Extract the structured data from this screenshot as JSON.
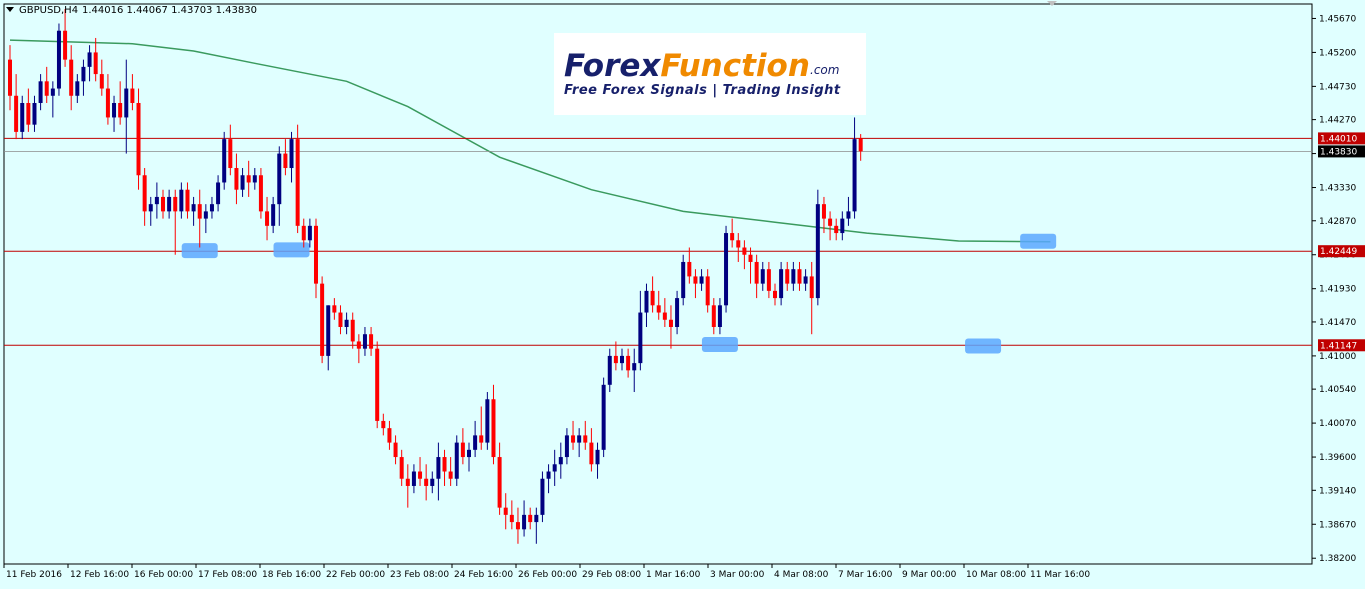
{
  "header": {
    "symbol": "GBPUSD,H4",
    "ohlc": "1.44016 1.44067 1.43703 1.43830"
  },
  "logo": {
    "brand_part1": "Forex",
    "brand_part2": "Function",
    "domain": ".com",
    "tagline": "Free Forex Signals | Trading Insight"
  },
  "colors": {
    "background": "#e0ffff",
    "bull_candle": "#000080",
    "bear_candle": "#ff0000",
    "moving_average": "#3a9a5e",
    "level_line": "#c00000",
    "price_line": "#8c8c8c",
    "highlight": "#5aa8ff",
    "logo_navy": "#17206b",
    "logo_orange": "#f08a00"
  },
  "chart_data": {
    "type": "candlestick",
    "symbol": "GBPUSD",
    "timeframe": "H4",
    "ylim": [
      1.3812,
      1.4587
    ],
    "y_ticks": [
      "1.45670",
      "1.45200",
      "1.44730",
      "1.44270",
      "1.43800",
      "1.43330",
      "1.42870",
      "1.42400",
      "1.41930",
      "1.41470",
      "1.41000",
      "1.40540",
      "1.40070",
      "1.39600",
      "1.39140",
      "1.38670",
      "1.38200"
    ],
    "x_ticks": [
      "11 Feb 2016",
      "12 Feb 16:00",
      "16 Feb 00:00",
      "17 Feb 08:00",
      "18 Feb 16:00",
      "22 Feb 00:00",
      "23 Feb 08:00",
      "24 Feb 16:00",
      "26 Feb 00:00",
      "29 Feb 08:00",
      "1 Mar 16:00",
      "3 Mar 00:00",
      "4 Mar 08:00",
      "7 Mar 16:00",
      "9 Mar 00:00",
      "10 Mar 08:00",
      "11 Mar 16:00"
    ],
    "levels": [
      {
        "label": "1.44010",
        "value": 1.4401
      },
      {
        "label": "1.42449",
        "value": 1.42449
      },
      {
        "label": "1.41147",
        "value": 1.41147
      }
    ],
    "current_price": {
      "label": "1.43830",
      "value": 1.4383
    },
    "highlights": [
      {
        "candle_index": 31,
        "price": 1.4245
      },
      {
        "candle_index": 46,
        "price": 1.4246
      },
      {
        "candle_index": 116,
        "price": 1.4115
      },
      {
        "candle_index": 159,
        "price": 1.4113
      },
      {
        "candle_index": 168,
        "price": 1.4258
      }
    ],
    "moving_average": [
      {
        "i": 0,
        "v": 1.4537
      },
      {
        "i": 20,
        "v": 1.4532
      },
      {
        "i": 30,
        "v": 1.4522
      },
      {
        "i": 40,
        "v": 1.4505
      },
      {
        "i": 55,
        "v": 1.448
      },
      {
        "i": 65,
        "v": 1.4445
      },
      {
        "i": 80,
        "v": 1.4375
      },
      {
        "i": 95,
        "v": 1.433
      },
      {
        "i": 110,
        "v": 1.43
      },
      {
        "i": 125,
        "v": 1.4285
      },
      {
        "i": 140,
        "v": 1.427
      },
      {
        "i": 155,
        "v": 1.4259
      },
      {
        "i": 170,
        "v": 1.4258
      }
    ],
    "candles": [
      [
        1.451,
        1.453,
        1.444,
        1.446
      ],
      [
        1.446,
        1.449,
        1.44,
        1.441
      ],
      [
        1.441,
        1.446,
        1.44,
        1.445
      ],
      [
        1.445,
        1.447,
        1.441,
        1.442
      ],
      [
        1.442,
        1.446,
        1.441,
        1.445
      ],
      [
        1.445,
        1.449,
        1.444,
        1.448
      ],
      [
        1.448,
        1.45,
        1.445,
        1.446
      ],
      [
        1.446,
        1.448,
        1.443,
        1.447
      ],
      [
        1.447,
        1.456,
        1.446,
        1.455
      ],
      [
        1.455,
        1.458,
        1.45,
        1.451
      ],
      [
        1.451,
        1.453,
        1.444,
        1.446
      ],
      [
        1.446,
        1.449,
        1.445,
        1.448
      ],
      [
        1.448,
        1.451,
        1.446,
        1.45
      ],
      [
        1.45,
        1.453,
        1.448,
        1.452
      ],
      [
        1.452,
        1.454,
        1.448,
        1.449
      ],
      [
        1.449,
        1.451,
        1.446,
        1.447
      ],
      [
        1.447,
        1.449,
        1.442,
        1.443
      ],
      [
        1.443,
        1.446,
        1.441,
        1.445
      ],
      [
        1.445,
        1.448,
        1.442,
        1.443
      ],
      [
        1.443,
        1.451,
        1.438,
        1.447
      ],
      [
        1.447,
        1.449,
        1.444,
        1.445
      ],
      [
        1.445,
        1.447,
        1.433,
        1.435
      ],
      [
        1.435,
        1.436,
        1.428,
        1.43
      ],
      [
        1.43,
        1.432,
        1.428,
        1.431
      ],
      [
        1.431,
        1.434,
        1.429,
        1.432
      ],
      [
        1.432,
        1.433,
        1.429,
        1.43
      ],
      [
        1.43,
        1.433,
        1.429,
        1.432
      ],
      [
        1.432,
        1.433,
        1.424,
        1.43
      ],
      [
        1.43,
        1.434,
        1.429,
        1.433
      ],
      [
        1.433,
        1.434,
        1.429,
        1.43
      ],
      [
        1.43,
        1.432,
        1.428,
        1.431
      ],
      [
        1.431,
        1.433,
        1.425,
        1.429
      ],
      [
        1.429,
        1.431,
        1.427,
        1.43
      ],
      [
        1.43,
        1.432,
        1.429,
        1.431
      ],
      [
        1.431,
        1.435,
        1.43,
        1.434
      ],
      [
        1.434,
        1.441,
        1.433,
        1.44
      ],
      [
        1.44,
        1.442,
        1.435,
        1.436
      ],
      [
        1.436,
        1.438,
        1.431,
        1.433
      ],
      [
        1.433,
        1.436,
        1.432,
        1.435
      ],
      [
        1.435,
        1.437,
        1.432,
        1.434
      ],
      [
        1.434,
        1.436,
        1.433,
        1.435
      ],
      [
        1.435,
        1.436,
        1.429,
        1.43
      ],
      [
        1.43,
        1.432,
        1.426,
        1.428
      ],
      [
        1.428,
        1.432,
        1.427,
        1.431
      ],
      [
        1.431,
        1.439,
        1.428,
        1.438
      ],
      [
        1.438,
        1.44,
        1.435,
        1.436
      ],
      [
        1.436,
        1.441,
        1.434,
        1.44
      ],
      [
        1.44,
        1.442,
        1.427,
        1.428
      ],
      [
        1.428,
        1.429,
        1.425,
        1.426
      ],
      [
        1.426,
        1.429,
        1.425,
        1.428
      ],
      [
        1.428,
        1.429,
        1.418,
        1.42
      ],
      [
        1.42,
        1.421,
        1.409,
        1.41
      ],
      [
        1.41,
        1.417,
        1.408,
        1.417
      ],
      [
        1.417,
        1.418,
        1.415,
        1.416
      ],
      [
        1.416,
        1.417,
        1.413,
        1.414
      ],
      [
        1.414,
        1.416,
        1.413,
        1.415
      ],
      [
        1.415,
        1.416,
        1.411,
        1.412
      ],
      [
        1.412,
        1.413,
        1.409,
        1.411
      ],
      [
        1.411,
        1.414,
        1.41,
        1.413
      ],
      [
        1.413,
        1.414,
        1.41,
        1.411
      ],
      [
        1.411,
        1.412,
        1.4,
        1.401
      ],
      [
        1.401,
        1.402,
        1.399,
        1.4
      ],
      [
        1.4,
        1.401,
        1.397,
        1.398
      ],
      [
        1.398,
        1.399,
        1.395,
        1.396
      ],
      [
        1.396,
        1.397,
        1.392,
        1.393
      ],
      [
        1.393,
        1.395,
        1.389,
        1.392
      ],
      [
        1.392,
        1.395,
        1.391,
        1.394
      ],
      [
        1.394,
        1.396,
        1.392,
        1.393
      ],
      [
        1.393,
        1.395,
        1.39,
        1.392
      ],
      [
        1.392,
        1.394,
        1.391,
        1.393
      ],
      [
        1.393,
        1.398,
        1.39,
        1.396
      ],
      [
        1.396,
        1.397,
        1.392,
        1.394
      ],
      [
        1.394,
        1.396,
        1.392,
        1.393
      ],
      [
        1.393,
        1.399,
        1.392,
        1.398
      ],
      [
        1.398,
        1.4,
        1.395,
        1.396
      ],
      [
        1.396,
        1.398,
        1.394,
        1.397
      ],
      [
        1.397,
        1.401,
        1.396,
        1.399
      ],
      [
        1.399,
        1.403,
        1.397,
        1.398
      ],
      [
        1.398,
        1.405,
        1.397,
        1.404
      ],
      [
        1.404,
        1.406,
        1.395,
        1.396
      ],
      [
        1.396,
        1.398,
        1.388,
        1.389
      ],
      [
        1.389,
        1.391,
        1.386,
        1.388
      ],
      [
        1.388,
        1.39,
        1.386,
        1.387
      ],
      [
        1.387,
        1.389,
        1.384,
        1.386
      ],
      [
        1.386,
        1.39,
        1.385,
        1.388
      ],
      [
        1.388,
        1.389,
        1.386,
        1.387
      ],
      [
        1.387,
        1.389,
        1.384,
        1.388
      ],
      [
        1.388,
        1.394,
        1.387,
        1.393
      ],
      [
        1.393,
        1.395,
        1.391,
        1.394
      ],
      [
        1.394,
        1.397,
        1.392,
        1.395
      ],
      [
        1.395,
        1.398,
        1.393,
        1.396
      ],
      [
        1.396,
        1.4,
        1.395,
        1.399
      ],
      [
        1.399,
        1.401,
        1.397,
        1.398
      ],
      [
        1.398,
        1.4,
        1.396,
        1.399
      ],
      [
        1.399,
        1.401,
        1.397,
        1.398
      ],
      [
        1.398,
        1.4,
        1.394,
        1.395
      ],
      [
        1.395,
        1.398,
        1.393,
        1.397
      ],
      [
        1.397,
        1.407,
        1.396,
        1.406
      ],
      [
        1.406,
        1.411,
        1.405,
        1.41
      ],
      [
        1.41,
        1.412,
        1.408,
        1.409
      ],
      [
        1.409,
        1.411,
        1.408,
        1.41
      ],
      [
        1.41,
        1.411,
        1.407,
        1.408
      ],
      [
        1.408,
        1.411,
        1.405,
        1.409
      ],
      [
        1.409,
        1.419,
        1.408,
        1.416
      ],
      [
        1.416,
        1.42,
        1.414,
        1.419
      ],
      [
        1.419,
        1.421,
        1.416,
        1.417
      ],
      [
        1.417,
        1.419,
        1.415,
        1.416
      ],
      [
        1.416,
        1.418,
        1.414,
        1.415
      ],
      [
        1.415,
        1.417,
        1.411,
        1.414
      ],
      [
        1.414,
        1.419,
        1.413,
        1.418
      ],
      [
        1.418,
        1.424,
        1.417,
        1.423
      ],
      [
        1.423,
        1.425,
        1.42,
        1.421
      ],
      [
        1.421,
        1.422,
        1.418,
        1.42
      ],
      [
        1.42,
        1.422,
        1.419,
        1.421
      ],
      [
        1.421,
        1.422,
        1.416,
        1.417
      ],
      [
        1.417,
        1.418,
        1.413,
        1.414
      ],
      [
        1.414,
        1.418,
        1.413,
        1.417
      ],
      [
        1.417,
        1.428,
        1.416,
        1.427
      ],
      [
        1.427,
        1.429,
        1.425,
        1.426
      ],
      [
        1.426,
        1.427,
        1.423,
        1.425
      ],
      [
        1.425,
        1.426,
        1.422,
        1.424
      ],
      [
        1.424,
        1.425,
        1.42,
        1.423
      ],
      [
        1.423,
        1.424,
        1.418,
        1.42
      ],
      [
        1.42,
        1.423,
        1.419,
        1.422
      ],
      [
        1.422,
        1.423,
        1.418,
        1.419
      ],
      [
        1.419,
        1.42,
        1.417,
        1.418
      ],
      [
        1.418,
        1.423,
        1.417,
        1.422
      ],
      [
        1.422,
        1.423,
        1.419,
        1.42
      ],
      [
        1.42,
        1.423,
        1.419,
        1.422
      ],
      [
        1.422,
        1.423,
        1.419,
        1.42
      ],
      [
        1.42,
        1.422,
        1.419,
        1.421
      ],
      [
        1.421,
        1.423,
        1.413,
        1.418
      ],
      [
        1.418,
        1.433,
        1.417,
        1.431
      ],
      [
        1.431,
        1.432,
        1.427,
        1.429
      ],
      [
        1.429,
        1.43,
        1.426,
        1.428
      ],
      [
        1.428,
        1.429,
        1.426,
        1.427
      ],
      [
        1.427,
        1.43,
        1.426,
        1.429
      ],
      [
        1.429,
        1.432,
        1.428,
        1.43
      ],
      [
        1.43,
        1.443,
        1.429,
        1.44
      ],
      [
        1.4401,
        1.4407,
        1.437,
        1.4383
      ]
    ]
  }
}
